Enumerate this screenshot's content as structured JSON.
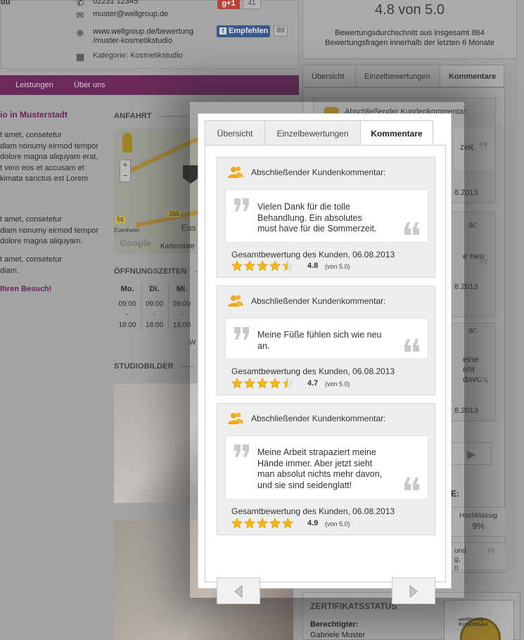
{
  "background": {
    "contact": {
      "phone": "02231 12345",
      "email": "muster@wellgroup.de",
      "url_line1": "www.wellgroup.de/bewertung",
      "url_line2": "/muster-kosmetikstudio",
      "category": "Kategorie: Kosmetikstudio",
      "label_top": "uu"
    },
    "share": {
      "gplus_label": "g+1",
      "gplus_count": "41",
      "fb_label": "Empfehlen",
      "fb_count": "89"
    },
    "nav": [
      "Leistungen",
      "Über uns"
    ],
    "studio_title": "io in Musterstadt",
    "body_text_1": [
      "t amet, consetetur",
      "diam nonumy eirmod tempor",
      "dolore magna aliquyam erat,",
      "t vero eos et accusam et",
      "kimata sanctus est Lorem"
    ],
    "body_text_2": [
      "t amet, consetetur",
      "diam nonumy eirmod tempor",
      "dolore magna aliquyam."
    ],
    "body_text_3": [
      "t amet, consetetur",
      "diam."
    ],
    "visit_text": "Ihren Besuch!",
    "anfahrt_heading": "ANFAHRT",
    "map": {
      "google": "Google",
      "kartendaten": "Kartendate",
      "road_label_1": "266",
      "road_label_2": "56",
      "town": "Eus",
      "town2": "Euenheim"
    },
    "hours_heading": "ÖFFNUNGSZEITEN",
    "hours": [
      {
        "day": "Mo.",
        "open": "09:00",
        "sep": "-",
        "close": "18:00"
      },
      {
        "day": "Di.",
        "open": "09:00",
        "sep": "-",
        "close": "18:00"
      },
      {
        "day": "Mi.",
        "open": "09:00",
        "sep": "-",
        "close": "18:00"
      }
    ],
    "hours_more": "W",
    "studiobilder_heading": "STUDIOBILDER",
    "rating": {
      "big": "4.8 von 5.0",
      "line1": "Bewertungsdurchschnitt aus insgesamt 864",
      "line2": "Bewertungsfragen innerhalb der letzten 6 Monate"
    },
    "right_tabs": [
      "Übersicht",
      "Einzelbewertungen",
      "Kommentare"
    ],
    "right_snippets": {
      "head": "Abschließender Kundenkommentar:",
      "frag1": "zeit.",
      "date1": "8.2013",
      "frag2": "ar:",
      "frag3": "e neu",
      "date2": "8.2013",
      "frag4": "ar:",
      "frag5a": "eine",
      "frag5b": "eht",
      "frag5c": "davon,",
      "date3": "8.2013",
      "frag6": "E:",
      "hochklassig": "Hochklassig",
      "percent": "9%",
      "frag7a": "und",
      "frag7b": "g,",
      "frag7c": "n"
    },
    "cert": {
      "title": "ZERTIFIKATSSTATUS",
      "label": "Berechtigter:",
      "name": "Gabriele Muster",
      "seal_text": "wellGroup KUNDENAU"
    }
  },
  "popup": {
    "tabs": [
      {
        "label": "Übersicht",
        "active": false
      },
      {
        "label": "Einzelbewertungen",
        "active": false
      },
      {
        "label": "Kommentare",
        "active": true
      }
    ],
    "comments": [
      {
        "heading": "Abschließender Kundenkommentar:",
        "lines": [
          "Vielen Dank für die tolle",
          "Behandlung. Ein absolutes",
          "must have für die Sommerzeit."
        ],
        "meta": "Gesamtbewertung des Kunden, 06.08.2013",
        "stars": 4.5,
        "score": "4.8",
        "von": "(von 5.0)"
      },
      {
        "heading": "Abschließender Kundenkommentar:",
        "lines": [
          "Meine Füße fühlen sich wie neu",
          "an."
        ],
        "meta": "Gesamtbewertung des Kunden, 06.08.2013",
        "stars": 4.5,
        "score": "4.7",
        "von": "(von 5.0)"
      },
      {
        "heading": "Abschließender Kundenkommentar:",
        "lines": [
          "Meine Arbeit strapaziert meine",
          "Hände immer. Aber jetzt sieht",
          "man absolut nichts mehr davon,",
          "und sie sind seidenglatt!"
        ],
        "meta": "Gesamtbewertung des Kunden, 06.08.2013",
        "stars": 5,
        "score": "4.9",
        "von": "(von 5.0)"
      }
    ]
  },
  "colors": {
    "accent_purple": "#8a2a77",
    "star_gold": "#f2b51a",
    "icon_orange": "#f0a81a"
  },
  "icons": [
    "phone-icon",
    "email-icon",
    "globe-icon",
    "category-icon",
    "users-icon",
    "quote-open-icon",
    "quote-close-icon",
    "star-icon",
    "arrow-left-icon",
    "arrow-right-icon"
  ]
}
